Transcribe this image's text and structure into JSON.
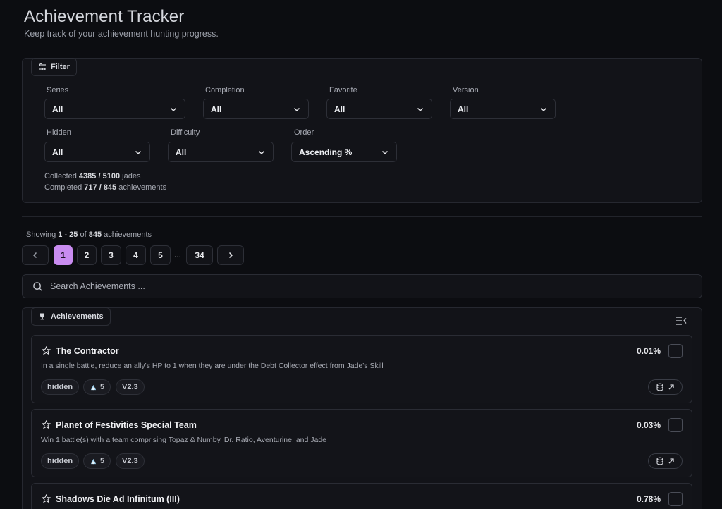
{
  "header": {
    "title": "Achievement Tracker",
    "subtitle": "Keep track of your achievement hunting progress."
  },
  "filter": {
    "label": "Filter",
    "fields": [
      {
        "label": "Series",
        "value": "All"
      },
      {
        "label": "Completion",
        "value": "All"
      },
      {
        "label": "Favorite",
        "value": "All"
      },
      {
        "label": "Version",
        "value": "All"
      },
      {
        "label": "Hidden",
        "value": "All"
      },
      {
        "label": "Difficulty",
        "value": "All"
      },
      {
        "label": "Order",
        "value": "Ascending %"
      }
    ],
    "stats": {
      "collected_prefix": "Collected",
      "collected_value": "4385",
      "collected_sep": "/",
      "collected_total": "5100",
      "collected_unit": "jades",
      "completed_prefix": "Completed",
      "completed_value": "717",
      "completed_sep": "/",
      "completed_total": "845",
      "completed_unit": "achievements"
    }
  },
  "pagination": {
    "showing_prefix": "Showing",
    "range": "1 - 25",
    "of_word": "of",
    "total": "845",
    "unit": "achievements",
    "pages": [
      "1",
      "2",
      "3",
      "4",
      "5"
    ],
    "ellipsis": "...",
    "last_page": "34",
    "current_page": "1"
  },
  "search": {
    "placeholder": "Search Achievements ..."
  },
  "achievements_section": {
    "label": "Achievements",
    "items": [
      {
        "name": "The Contractor",
        "description": "In a single battle, reduce an ally's HP to 1 when they are under the Debt Collector effect from Jade's Skill",
        "percent": "0.01%",
        "tags": {
          "hidden": "hidden",
          "reward": "5",
          "version": "V2.3"
        }
      },
      {
        "name": "Planet of Festivities Special Team",
        "description": "Win 1 battle(s) with a team comprising Topaz & Numby, Dr. Ratio, Aventurine, and Jade",
        "percent": "0.03%",
        "tags": {
          "hidden": "hidden",
          "reward": "5",
          "version": "V2.3"
        }
      },
      {
        "name": "Shadows Die Ad Infinitum (III)",
        "description": "",
        "percent": "0.78%",
        "tags": {}
      }
    ]
  },
  "colors": {
    "accent": "#c98cf0",
    "background": "#0c0d11",
    "panel": "#121318"
  },
  "icons": {
    "filter": "sliders-icon",
    "achievements": "trophy-icon",
    "search": "search-icon",
    "collapse": "collapse-list-icon",
    "favorite": "star-icon",
    "reward": "jade-icon",
    "database_link": "database-link-icon"
  }
}
